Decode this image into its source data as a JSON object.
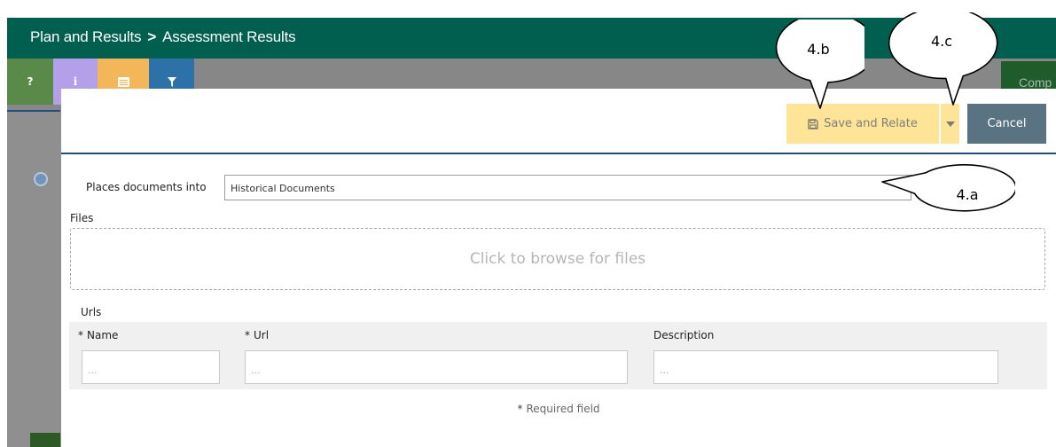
{
  "header": {
    "breadcrumb_parent": "Plan and Results",
    "breadcrumb_separator": ">",
    "breadcrumb_current": "Assessment Results",
    "bg_button_partial": "Comp"
  },
  "toolbar_icons": {
    "help": "?",
    "info": "i",
    "list_icon": "list-icon",
    "filter_icon": "filter-icon"
  },
  "dialog": {
    "save_relate_label": "Save and Relate",
    "cancel_label": "Cancel",
    "places_label": "Places documents into",
    "places_value": "Historical Documents",
    "files_label": "Files",
    "dropzone_text": "Click to browse for files",
    "urls_label": "Urls",
    "columns": {
      "name": "Name",
      "url": "Url",
      "description": "Description"
    },
    "placeholders": {
      "name": "...",
      "url": "...",
      "description": "..."
    },
    "required_asterisk": "*",
    "required_note": "Required field"
  },
  "callouts": {
    "a": "4.a",
    "b": "4.b",
    "c": "4.c"
  },
  "colors": {
    "header_bg": "#005f4f",
    "save_bg": "#fde497",
    "cancel_bg": "#5a7383",
    "accent_line": "#1f4f85"
  }
}
